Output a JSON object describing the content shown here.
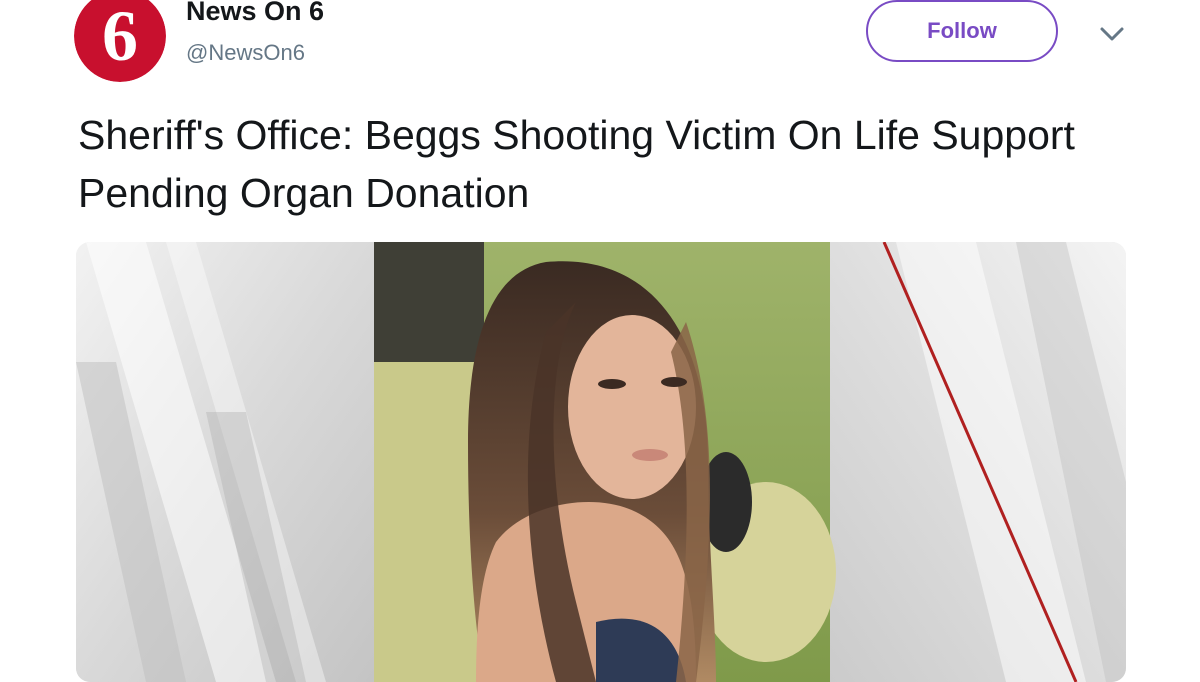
{
  "account": {
    "display_name": "News On 6",
    "handle": "@NewsOn6",
    "avatar_icon": "news-on-6-logo",
    "logo_text": "6"
  },
  "actions": {
    "follow_label": "Follow",
    "menu_icon": "chevron-down-icon"
  },
  "tweet": {
    "text": "Sheriff's Office: Beggs Shooting Victim On Life Support Pending Organ Donation"
  },
  "media": {
    "description_icon": "photo"
  },
  "colors": {
    "accent": "#794bc4",
    "logo_red": "#c8102e",
    "handle_gray": "#657786",
    "text": "#14171a"
  }
}
